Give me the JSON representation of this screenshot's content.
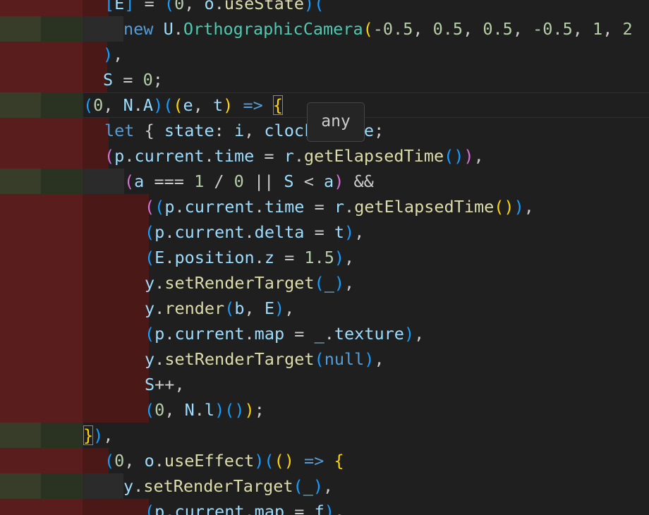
{
  "editor": {
    "colors": {
      "background": "#1f1f1f",
      "removed_line": "#4b1818",
      "removed_gutter": "#5a1d1d",
      "changed_gutter": "#373d29",
      "inserted_gutter": "#2a3321",
      "keyword": "#569cd6",
      "control": "#c586c0",
      "function": "#dcdcaa",
      "class": "#4ec9b0",
      "variable": "#9cdcfe",
      "number": "#b5cea8",
      "bracket_1": "#ffd700",
      "bracket_2": "#da70d6",
      "bracket_3": "#179fff"
    },
    "lines": [
      {
        "kind": "removed",
        "tokens": [
          [
            "[",
            "p3"
          ],
          [
            "E",
            "var"
          ],
          [
            "]",
            "p3"
          ],
          [
            " = ",
            "pl"
          ],
          [
            "(",
            "p3"
          ],
          [
            "0",
            "num"
          ],
          [
            ", ",
            "pl"
          ],
          [
            "o",
            "var"
          ],
          [
            ".",
            "pl"
          ],
          [
            "useState",
            "fn"
          ],
          [
            ")",
            "p3"
          ],
          [
            "(",
            "p3"
          ]
        ]
      },
      {
        "kind": "changed",
        "tokens": [
          [
            "new",
            "kw"
          ],
          [
            " ",
            "pl"
          ],
          [
            "U",
            "var"
          ],
          [
            ".",
            "pl"
          ],
          [
            "OrthographicCamera",
            "cls"
          ],
          [
            "(",
            "p1"
          ],
          [
            "-0.5",
            "num"
          ],
          [
            ", ",
            "pl"
          ],
          [
            "0.5",
            "num"
          ],
          [
            ", ",
            "pl"
          ],
          [
            "0.5",
            "num"
          ],
          [
            ", ",
            "pl"
          ],
          [
            "-0.5",
            "num"
          ],
          [
            ", ",
            "pl"
          ],
          [
            "1",
            "num"
          ],
          [
            ", ",
            "pl"
          ],
          [
            "2",
            "num"
          ]
        ]
      },
      {
        "kind": "removed",
        "tokens": [
          [
            ")",
            "p3"
          ],
          [
            ",",
            "pl"
          ]
        ]
      },
      {
        "kind": "removed",
        "tokens": [
          [
            "S",
            "var"
          ],
          [
            " = ",
            "pl"
          ],
          [
            "0",
            "num"
          ],
          [
            ";",
            "pl"
          ]
        ]
      },
      {
        "kind": "changed",
        "tokens": [
          [
            "(",
            "p3"
          ],
          [
            "0",
            "num"
          ],
          [
            ", ",
            "pl"
          ],
          [
            "N",
            "var"
          ],
          [
            ".",
            "pl"
          ],
          [
            "A",
            "var"
          ],
          [
            ")",
            "p3"
          ],
          [
            "(",
            "p3"
          ],
          [
            "(",
            "p1"
          ],
          [
            "e",
            "var"
          ],
          [
            ", ",
            "pl"
          ],
          [
            "t",
            "var"
          ],
          [
            ")",
            "p1"
          ],
          [
            " => ",
            "kw"
          ],
          [
            "{",
            "p1"
          ]
        ]
      },
      {
        "kind": "removed",
        "tokens": [
          [
            "let",
            "kw"
          ],
          [
            " { ",
            "pl"
          ],
          [
            "state",
            "var"
          ],
          [
            ": ",
            "pl"
          ],
          [
            "i",
            "var"
          ],
          [
            ", ",
            "pl"
          ],
          [
            "clock",
            "var"
          ],
          [
            " } = ",
            "pl"
          ],
          [
            "e",
            "var"
          ],
          [
            ";",
            "pl"
          ]
        ]
      },
      {
        "kind": "removed",
        "tokens": [
          [
            "(",
            "p2"
          ],
          [
            "p",
            "var"
          ],
          [
            ".",
            "pl"
          ],
          [
            "current",
            "var"
          ],
          [
            ".",
            "pl"
          ],
          [
            "time",
            "var"
          ],
          [
            " = ",
            "pl"
          ],
          [
            "r",
            "var"
          ],
          [
            ".",
            "pl"
          ],
          [
            "getElapsedTime",
            "fn"
          ],
          [
            "(",
            "p3"
          ],
          [
            ")",
            "p3"
          ],
          [
            ")",
            "p2"
          ],
          [
            ",",
            "pl"
          ]
        ]
      },
      {
        "kind": "changed",
        "tokens": [
          [
            "(",
            "p2"
          ],
          [
            "a",
            "var"
          ],
          [
            " === ",
            "pl"
          ],
          [
            "1",
            "num"
          ],
          [
            " / ",
            "pl"
          ],
          [
            "0",
            "num"
          ],
          [
            " || ",
            "pl"
          ],
          [
            "S",
            "var"
          ],
          [
            " < ",
            "pl"
          ],
          [
            "a",
            "var"
          ],
          [
            ")",
            "p2"
          ],
          [
            " &&",
            "pl"
          ]
        ]
      },
      {
        "kind": "removed",
        "tokens": [
          [
            "(",
            "p2"
          ],
          [
            "(",
            "p3"
          ],
          [
            "p",
            "var"
          ],
          [
            ".",
            "pl"
          ],
          [
            "current",
            "var"
          ],
          [
            ".",
            "pl"
          ],
          [
            "time",
            "var"
          ],
          [
            " = ",
            "pl"
          ],
          [
            "r",
            "var"
          ],
          [
            ".",
            "pl"
          ],
          [
            "getElapsedTime",
            "fn"
          ],
          [
            "(",
            "p1"
          ],
          [
            ")",
            "p1"
          ],
          [
            ")",
            "p3"
          ],
          [
            ",",
            "pl"
          ]
        ]
      },
      {
        "kind": "removed",
        "tokens": [
          [
            "(",
            "p3"
          ],
          [
            "p",
            "var"
          ],
          [
            ".",
            "pl"
          ],
          [
            "current",
            "var"
          ],
          [
            ".",
            "pl"
          ],
          [
            "delta",
            "var"
          ],
          [
            " = ",
            "pl"
          ],
          [
            "t",
            "var"
          ],
          [
            ")",
            "p3"
          ],
          [
            ",",
            "pl"
          ]
        ]
      },
      {
        "kind": "removed",
        "tokens": [
          [
            "(",
            "p3"
          ],
          [
            "E",
            "var"
          ],
          [
            ".",
            "pl"
          ],
          [
            "position",
            "var"
          ],
          [
            ".",
            "pl"
          ],
          [
            "z",
            "var"
          ],
          [
            " = ",
            "pl"
          ],
          [
            "1.5",
            "num"
          ],
          [
            ")",
            "p3"
          ],
          [
            ",",
            "pl"
          ]
        ]
      },
      {
        "kind": "removed",
        "tokens": [
          [
            "y",
            "var"
          ],
          [
            ".",
            "pl"
          ],
          [
            "setRenderTarget",
            "fn"
          ],
          [
            "(",
            "p3"
          ],
          [
            "_",
            "var"
          ],
          [
            ")",
            "p3"
          ],
          [
            ",",
            "pl"
          ]
        ]
      },
      {
        "kind": "removed",
        "tokens": [
          [
            "y",
            "var"
          ],
          [
            ".",
            "pl"
          ],
          [
            "render",
            "fn"
          ],
          [
            "(",
            "p3"
          ],
          [
            "b",
            "var"
          ],
          [
            ", ",
            "pl"
          ],
          [
            "E",
            "var"
          ],
          [
            ")",
            "p3"
          ],
          [
            ",",
            "pl"
          ]
        ]
      },
      {
        "kind": "removed",
        "tokens": [
          [
            "(",
            "p3"
          ],
          [
            "p",
            "var"
          ],
          [
            ".",
            "pl"
          ],
          [
            "current",
            "var"
          ],
          [
            ".",
            "pl"
          ],
          [
            "map",
            "var"
          ],
          [
            " = ",
            "pl"
          ],
          [
            "_",
            "var"
          ],
          [
            ".",
            "pl"
          ],
          [
            "texture",
            "var"
          ],
          [
            ")",
            "p3"
          ],
          [
            ",",
            "pl"
          ]
        ]
      },
      {
        "kind": "removed",
        "tokens": [
          [
            "y",
            "var"
          ],
          [
            ".",
            "pl"
          ],
          [
            "setRenderTarget",
            "fn"
          ],
          [
            "(",
            "p3"
          ],
          [
            "null",
            "kw"
          ],
          [
            ")",
            "p3"
          ],
          [
            ",",
            "pl"
          ]
        ]
      },
      {
        "kind": "removed",
        "tokens": [
          [
            "S",
            "var"
          ],
          [
            "++",
            "pl"
          ],
          [
            ",",
            "pl"
          ]
        ]
      },
      {
        "kind": "removed",
        "tokens": [
          [
            "(",
            "p3"
          ],
          [
            "0",
            "num"
          ],
          [
            ", ",
            "pl"
          ],
          [
            "N",
            "var"
          ],
          [
            ".",
            "pl"
          ],
          [
            "l",
            "var"
          ],
          [
            ")",
            "p3"
          ],
          [
            "(",
            "p3"
          ],
          [
            ")",
            "p3"
          ],
          [
            ")",
            "p1"
          ],
          [
            ";",
            "pl"
          ]
        ]
      },
      {
        "kind": "changed",
        "tokens": [
          [
            "}",
            "p1"
          ],
          [
            ")",
            "p3"
          ],
          [
            ",",
            "pl"
          ]
        ]
      },
      {
        "kind": "removed",
        "tokens": [
          [
            "(",
            "p3"
          ],
          [
            "0",
            "num"
          ],
          [
            ", ",
            "pl"
          ],
          [
            "o",
            "var"
          ],
          [
            ".",
            "pl"
          ],
          [
            "useEffect",
            "fn"
          ],
          [
            ")",
            "p3"
          ],
          [
            "(",
            "p3"
          ],
          [
            "(",
            "p1"
          ],
          [
            ")",
            "p1"
          ],
          [
            " => ",
            "kw"
          ],
          [
            "{",
            "p1"
          ]
        ]
      },
      {
        "kind": "changed",
        "tokens": [
          [
            "y",
            "var"
          ],
          [
            ".",
            "pl"
          ],
          [
            "setRenderTarget",
            "fn"
          ],
          [
            "(",
            "p3"
          ],
          [
            "_",
            "var"
          ],
          [
            ")",
            "p3"
          ],
          [
            ",",
            "pl"
          ]
        ]
      },
      {
        "kind": "removed",
        "tokens": [
          [
            "(",
            "p3"
          ],
          [
            "p",
            "var"
          ],
          [
            ".",
            "pl"
          ],
          [
            "current",
            "var"
          ],
          [
            ".",
            "pl"
          ],
          [
            "map",
            "var"
          ],
          [
            " = ",
            "pl"
          ],
          [
            "f",
            "var"
          ],
          [
            ")",
            "p3"
          ],
          [
            ",",
            "pl"
          ]
        ]
      }
    ]
  },
  "tooltip": {
    "text": "any"
  }
}
